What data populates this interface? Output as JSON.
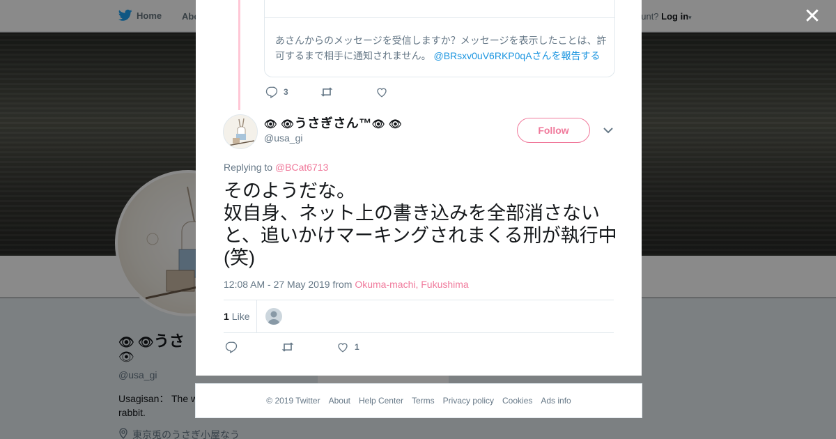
{
  "nav": {
    "home_label": "Home",
    "about_label": "Abo",
    "login_prompt": "ccount?",
    "login_label": "Log in"
  },
  "profile": {
    "name": "うさ",
    "handle": "@usa_gi",
    "bio": "Usagisan： The w rabbit.",
    "location": "東京兎のうさぎ小屋なう",
    "tab_partial": "Ads info"
  },
  "quoted": {
    "text": "あさんからのメッセージを受信しますか？メッセージを表示したことは、許可するまで相手に通知されません。",
    "report_link": "@BRsxv0uV6RKP0qAさんを報告する"
  },
  "prev_actions": {
    "reply_count": "3",
    "retweet_count": "",
    "like_count": ""
  },
  "tweet": {
    "author_name": "うさぎさん™",
    "author_handle": "@usa_gi",
    "follow_label": "Follow",
    "replying_prefix": "Replying to",
    "replying_to": "@BCat6713",
    "text": "そのようだな。\n奴自身、ネット上の書き込みを全部消さないと、追いかけマーキングされまくる刑が執行中(笑)",
    "timestamp": "12:08 AM - 27 May 2019",
    "from_label": "from",
    "location": "Okuma-machi, Fukushima",
    "like_stat_count": "1",
    "like_stat_label": "Like",
    "reply_count": "",
    "retweet_count": "",
    "like_count": "1"
  },
  "footer": {
    "copyright": "© 2019 Twitter",
    "links": [
      "About",
      "Help Center",
      "Terms",
      "Privacy policy",
      "Cookies",
      "Ads info"
    ]
  },
  "colors": {
    "accent": "#f0799b",
    "link_blue": "#1b95e0",
    "thread_line": "#ffc7d6",
    "muted": "#657786",
    "twitter_blue": "#1da1f2"
  },
  "icons": {
    "close": "close-icon",
    "twitter": "twitter-bird-icon",
    "eye_emoji": "👁"
  }
}
